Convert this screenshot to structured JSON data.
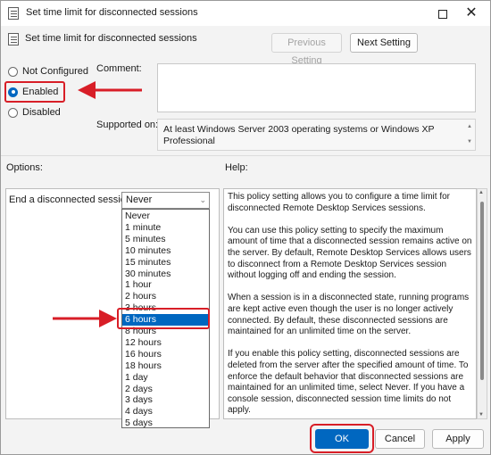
{
  "window": {
    "title": "Set time limit for disconnected sessions",
    "close_glyph": "✕"
  },
  "header": {
    "policy_title": "Set time limit for disconnected sessions",
    "prev_setting": "Previous Setting",
    "next_setting": "Next Setting"
  },
  "state": {
    "not_configured": "Not Configured",
    "enabled": "Enabled",
    "disabled": "Disabled",
    "selected": "Enabled"
  },
  "comment": {
    "label": "Comment:",
    "value": ""
  },
  "supported": {
    "label": "Supported on:",
    "value": "At least Windows Server 2003 operating systems or Windows XP Professional"
  },
  "options": {
    "label": "Options:",
    "setting_label": "End a disconnected session",
    "current_value": "Never",
    "dropdown_items": [
      "Never",
      "1 minute",
      "5 minutes",
      "10 minutes",
      "15 minutes",
      "30 minutes",
      "1 hour",
      "2 hours",
      "3 hours",
      "6 hours",
      "8 hours",
      "12 hours",
      "16 hours",
      "18 hours",
      "1 day",
      "2 days",
      "3 days",
      "4 days",
      "5 days"
    ],
    "highlighted_item": "6 hours"
  },
  "help": {
    "label": "Help:",
    "paragraphs": [
      "This policy setting allows you to configure a time limit for disconnected Remote Desktop Services sessions.",
      "You can use this policy setting to specify the maximum amount of time that a disconnected session remains active on the server. By default, Remote Desktop Services allows users to disconnect from a Remote Desktop Services session without logging off and ending the session.",
      "When a session is in a disconnected state, running programs are kept active even though the user is no longer actively connected. By default, these disconnected sessions are maintained for an unlimited time on the server.",
      "If you enable this policy setting, disconnected sessions are deleted from the server after the specified amount of time. To enforce the default behavior that disconnected sessions are maintained for an unlimited time, select Never. If you have a console session, disconnected session time limits do not apply."
    ]
  },
  "footer": {
    "ok": "OK",
    "cancel": "Cancel",
    "apply": "Apply"
  },
  "colors": {
    "accent": "#0067c0",
    "annotation_red": "#d81e27"
  }
}
